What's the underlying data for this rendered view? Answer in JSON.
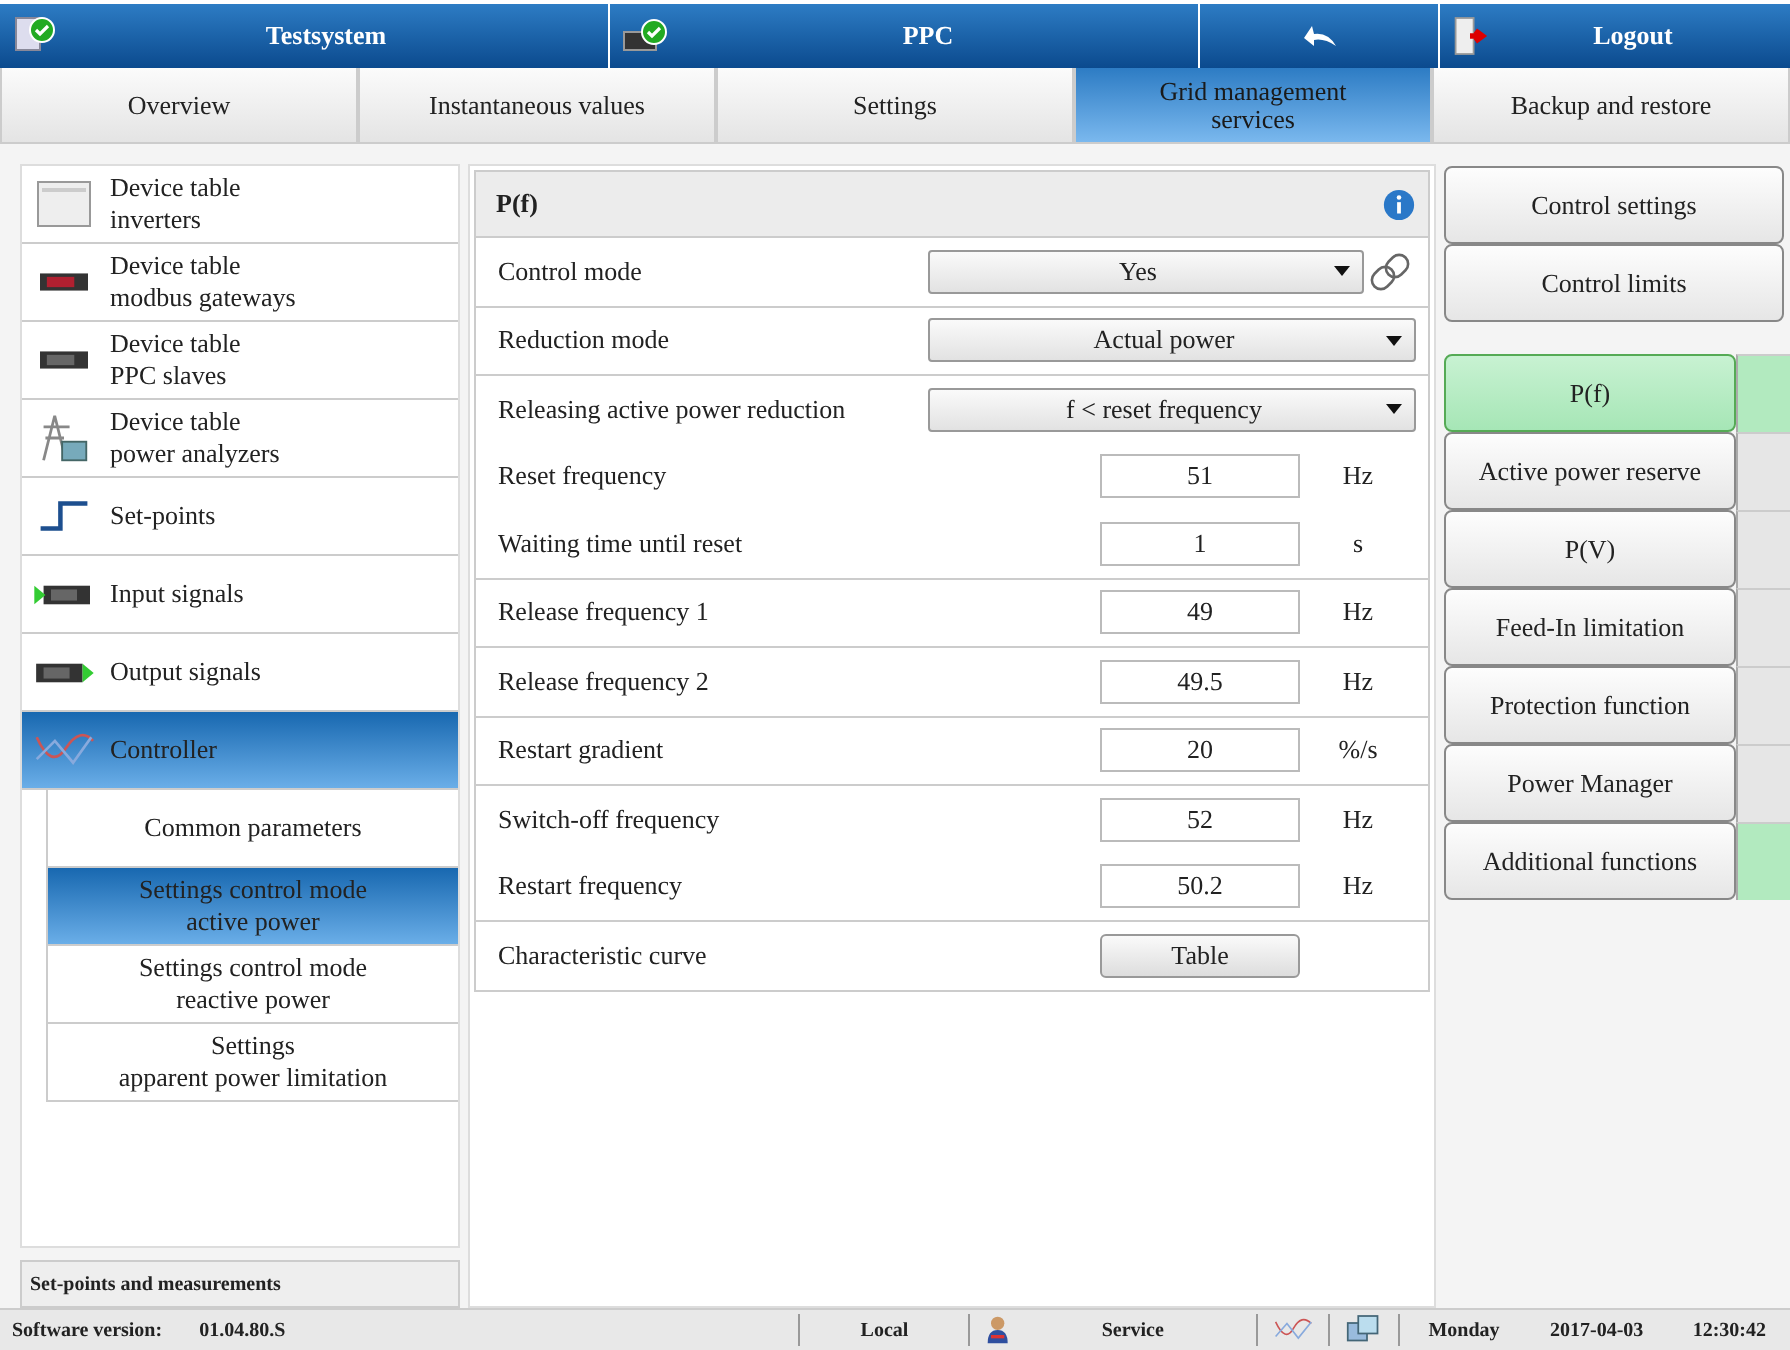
{
  "header": {
    "system": "Testsystem",
    "device": "PPC",
    "logout": "Logout"
  },
  "tabs": [
    {
      "label": "Overview",
      "selected": false
    },
    {
      "label": "Instantaneous values",
      "selected": false
    },
    {
      "label": "Settings",
      "selected": false
    },
    {
      "label": "Grid management services",
      "selected": true
    },
    {
      "label": "Backup and restore",
      "selected": false
    }
  ],
  "sidebar": {
    "items": [
      {
        "lines": [
          "Device table",
          "inverters"
        ],
        "selected": false
      },
      {
        "lines": [
          "Device table",
          "modbus gateways"
        ],
        "selected": false
      },
      {
        "lines": [
          "Device table",
          "PPC slaves"
        ],
        "selected": false
      },
      {
        "lines": [
          "Device table",
          "power analyzers"
        ],
        "selected": false
      },
      {
        "lines": [
          "Set-points"
        ],
        "selected": false
      },
      {
        "lines": [
          "Input signals"
        ],
        "selected": false
      },
      {
        "lines": [
          "Output signals"
        ],
        "selected": false
      },
      {
        "lines": [
          "Controller"
        ],
        "selected": true
      }
    ],
    "subitems": [
      {
        "lines": [
          "Common parameters"
        ],
        "selected": false
      },
      {
        "lines": [
          "Settings control mode",
          "active power"
        ],
        "selected": true
      },
      {
        "lines": [
          "Settings control mode",
          "reactive power"
        ],
        "selected": false
      },
      {
        "lines": [
          "Settings",
          "apparent power limitation"
        ],
        "selected": false
      }
    ],
    "footer": "Set-points and measurements"
  },
  "panel": {
    "title": "P(f)",
    "groups": [
      {
        "rows": [
          {
            "kind": "select",
            "label": "Control mode",
            "value": "Yes",
            "linked": true
          }
        ]
      },
      {
        "rows": [
          {
            "kind": "select",
            "label": "Reduction mode",
            "value": "Actual power",
            "linked": false
          }
        ]
      },
      {
        "rows": [
          {
            "kind": "select",
            "label": "Releasing active power reduction",
            "value": "f < reset frequency",
            "linked": false
          },
          {
            "kind": "number",
            "label": "Reset frequency",
            "value": "51",
            "unit": "Hz"
          },
          {
            "kind": "number",
            "label": "Waiting time until reset",
            "value": "1",
            "unit": "s"
          }
        ]
      },
      {
        "rows": [
          {
            "kind": "number",
            "label": "Release frequency 1",
            "value": "49",
            "unit": "Hz"
          }
        ]
      },
      {
        "rows": [
          {
            "kind": "number",
            "label": "Release frequency 2",
            "value": "49.5",
            "unit": "Hz"
          }
        ]
      },
      {
        "rows": [
          {
            "kind": "number",
            "label": "Restart gradient",
            "value": "20",
            "unit": "%/s"
          }
        ]
      },
      {
        "rows": [
          {
            "kind": "number",
            "label": "Switch-off frequency",
            "value": "52",
            "unit": "Hz"
          },
          {
            "kind": "number",
            "label": "Restart frequency",
            "value": "50.2",
            "unit": "Hz"
          }
        ]
      },
      {
        "rows": [
          {
            "kind": "button",
            "label": "Characteristic curve",
            "value": "Table"
          }
        ]
      }
    ]
  },
  "top_buttons": [
    "Control settings",
    "Control limits"
  ],
  "functions": [
    {
      "label": "P(f)",
      "selected": true,
      "active": true
    },
    {
      "label": "Active power reserve",
      "selected": false,
      "active": false
    },
    {
      "label": "P(V)",
      "selected": false,
      "active": false
    },
    {
      "label": "Feed-In limitation",
      "selected": false,
      "active": false
    },
    {
      "label": "Protection function",
      "selected": false,
      "active": false
    },
    {
      "label": "Power Manager",
      "selected": false,
      "active": false
    },
    {
      "label": "Additional functions",
      "selected": false,
      "active": true
    }
  ],
  "status_bar": {
    "version_label": "Software version:",
    "version": "01.04.80.S",
    "access": "Local",
    "user": "Service",
    "day": "Monday",
    "date": "2017-04-03",
    "time": "12:30:42"
  }
}
